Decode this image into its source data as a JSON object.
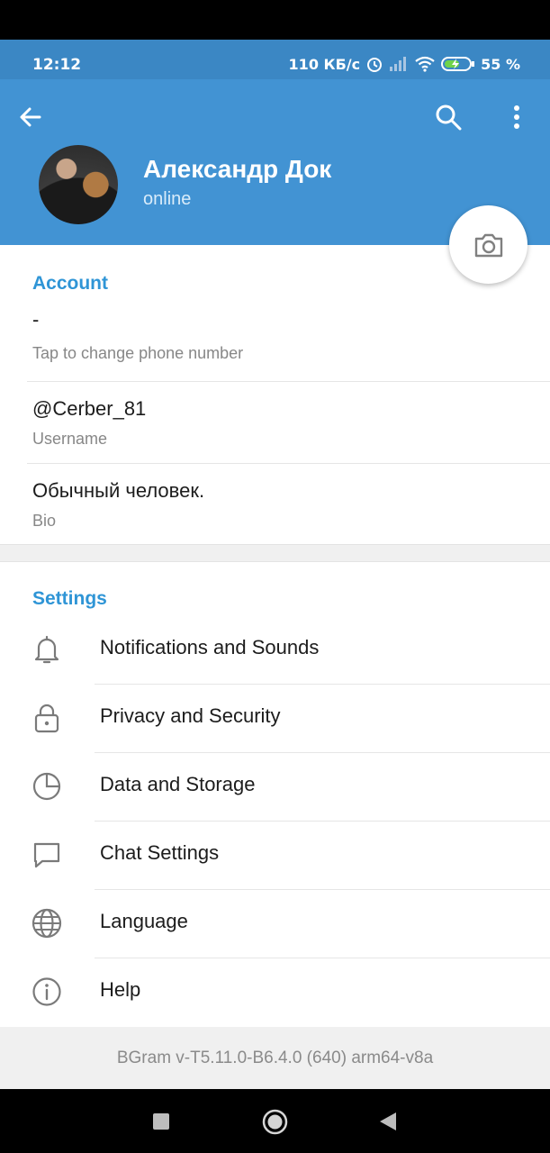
{
  "status_bar": {
    "time": "12:12",
    "speed": "110 КБ/с",
    "battery": "55 %"
  },
  "header": {
    "name": "Александр Док",
    "status": "online"
  },
  "account": {
    "section_title": "Account",
    "phone_value": "-",
    "phone_hint": "Tap to change phone number",
    "username": "@Cerber_81",
    "username_label": "Username",
    "bio": "Обычный человек.",
    "bio_label": "Bio"
  },
  "settings": {
    "section_title": "Settings",
    "items": [
      {
        "label": "Notifications and Sounds",
        "icon": "bell-icon"
      },
      {
        "label": "Privacy and Security",
        "icon": "lock-icon"
      },
      {
        "label": "Data and Storage",
        "icon": "pie-chart-icon"
      },
      {
        "label": "Chat Settings",
        "icon": "chat-bubble-icon"
      },
      {
        "label": "Language",
        "icon": "globe-icon"
      },
      {
        "label": "Help",
        "icon": "info-icon"
      }
    ]
  },
  "footer": {
    "version": "BGram v-T5.11.0-B6.4.0 (640) arm64-v8a"
  },
  "colors": {
    "header": "#4293d3",
    "status_bar": "#3b87c4",
    "accent": "#2f95d6"
  }
}
